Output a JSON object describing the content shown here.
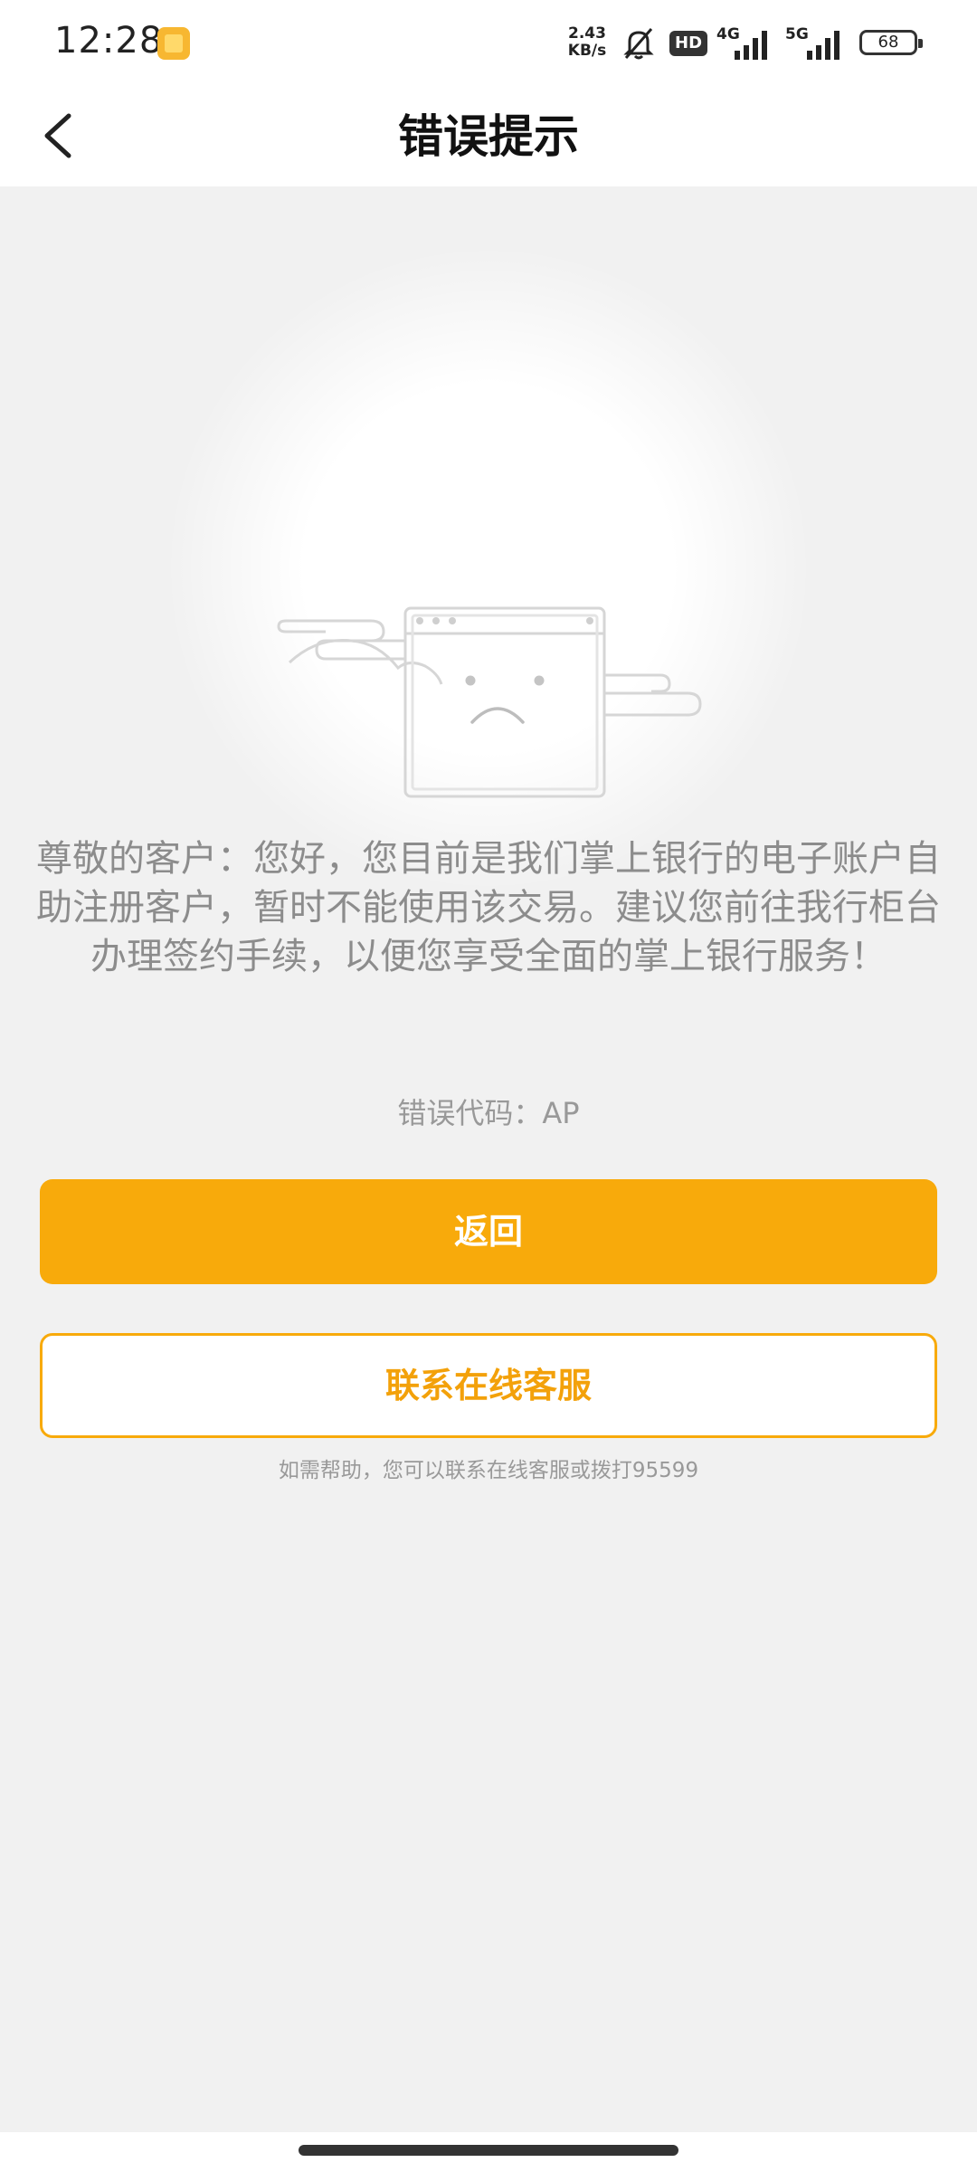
{
  "status_bar": {
    "time": "12:28",
    "net_speed_value": "2.43",
    "net_speed_unit": "KB/s",
    "hd_label": "HD",
    "network_1": "4G",
    "network_2": "5G",
    "battery": "68"
  },
  "header": {
    "title": "错误提示",
    "back_icon": "chevron-left-icon"
  },
  "error": {
    "illustration": "sad-window-with-clouds",
    "message": "尊敬的客户：您好，您目前是我们掌上银行的电子账户自助注册客户，暂时不能使用该交易。建议您前往我行柜台办理签约手续，以便您享受全面的掌上银行服务！",
    "code_text": "错误代码：AP"
  },
  "actions": {
    "back_label": "返回",
    "contact_label": "联系在线客服"
  },
  "help_text": "如需帮助，您可以联系在线客服或拨打95599",
  "colors": {
    "accent": "#f8aa0b",
    "background": "#f1f1f1"
  }
}
